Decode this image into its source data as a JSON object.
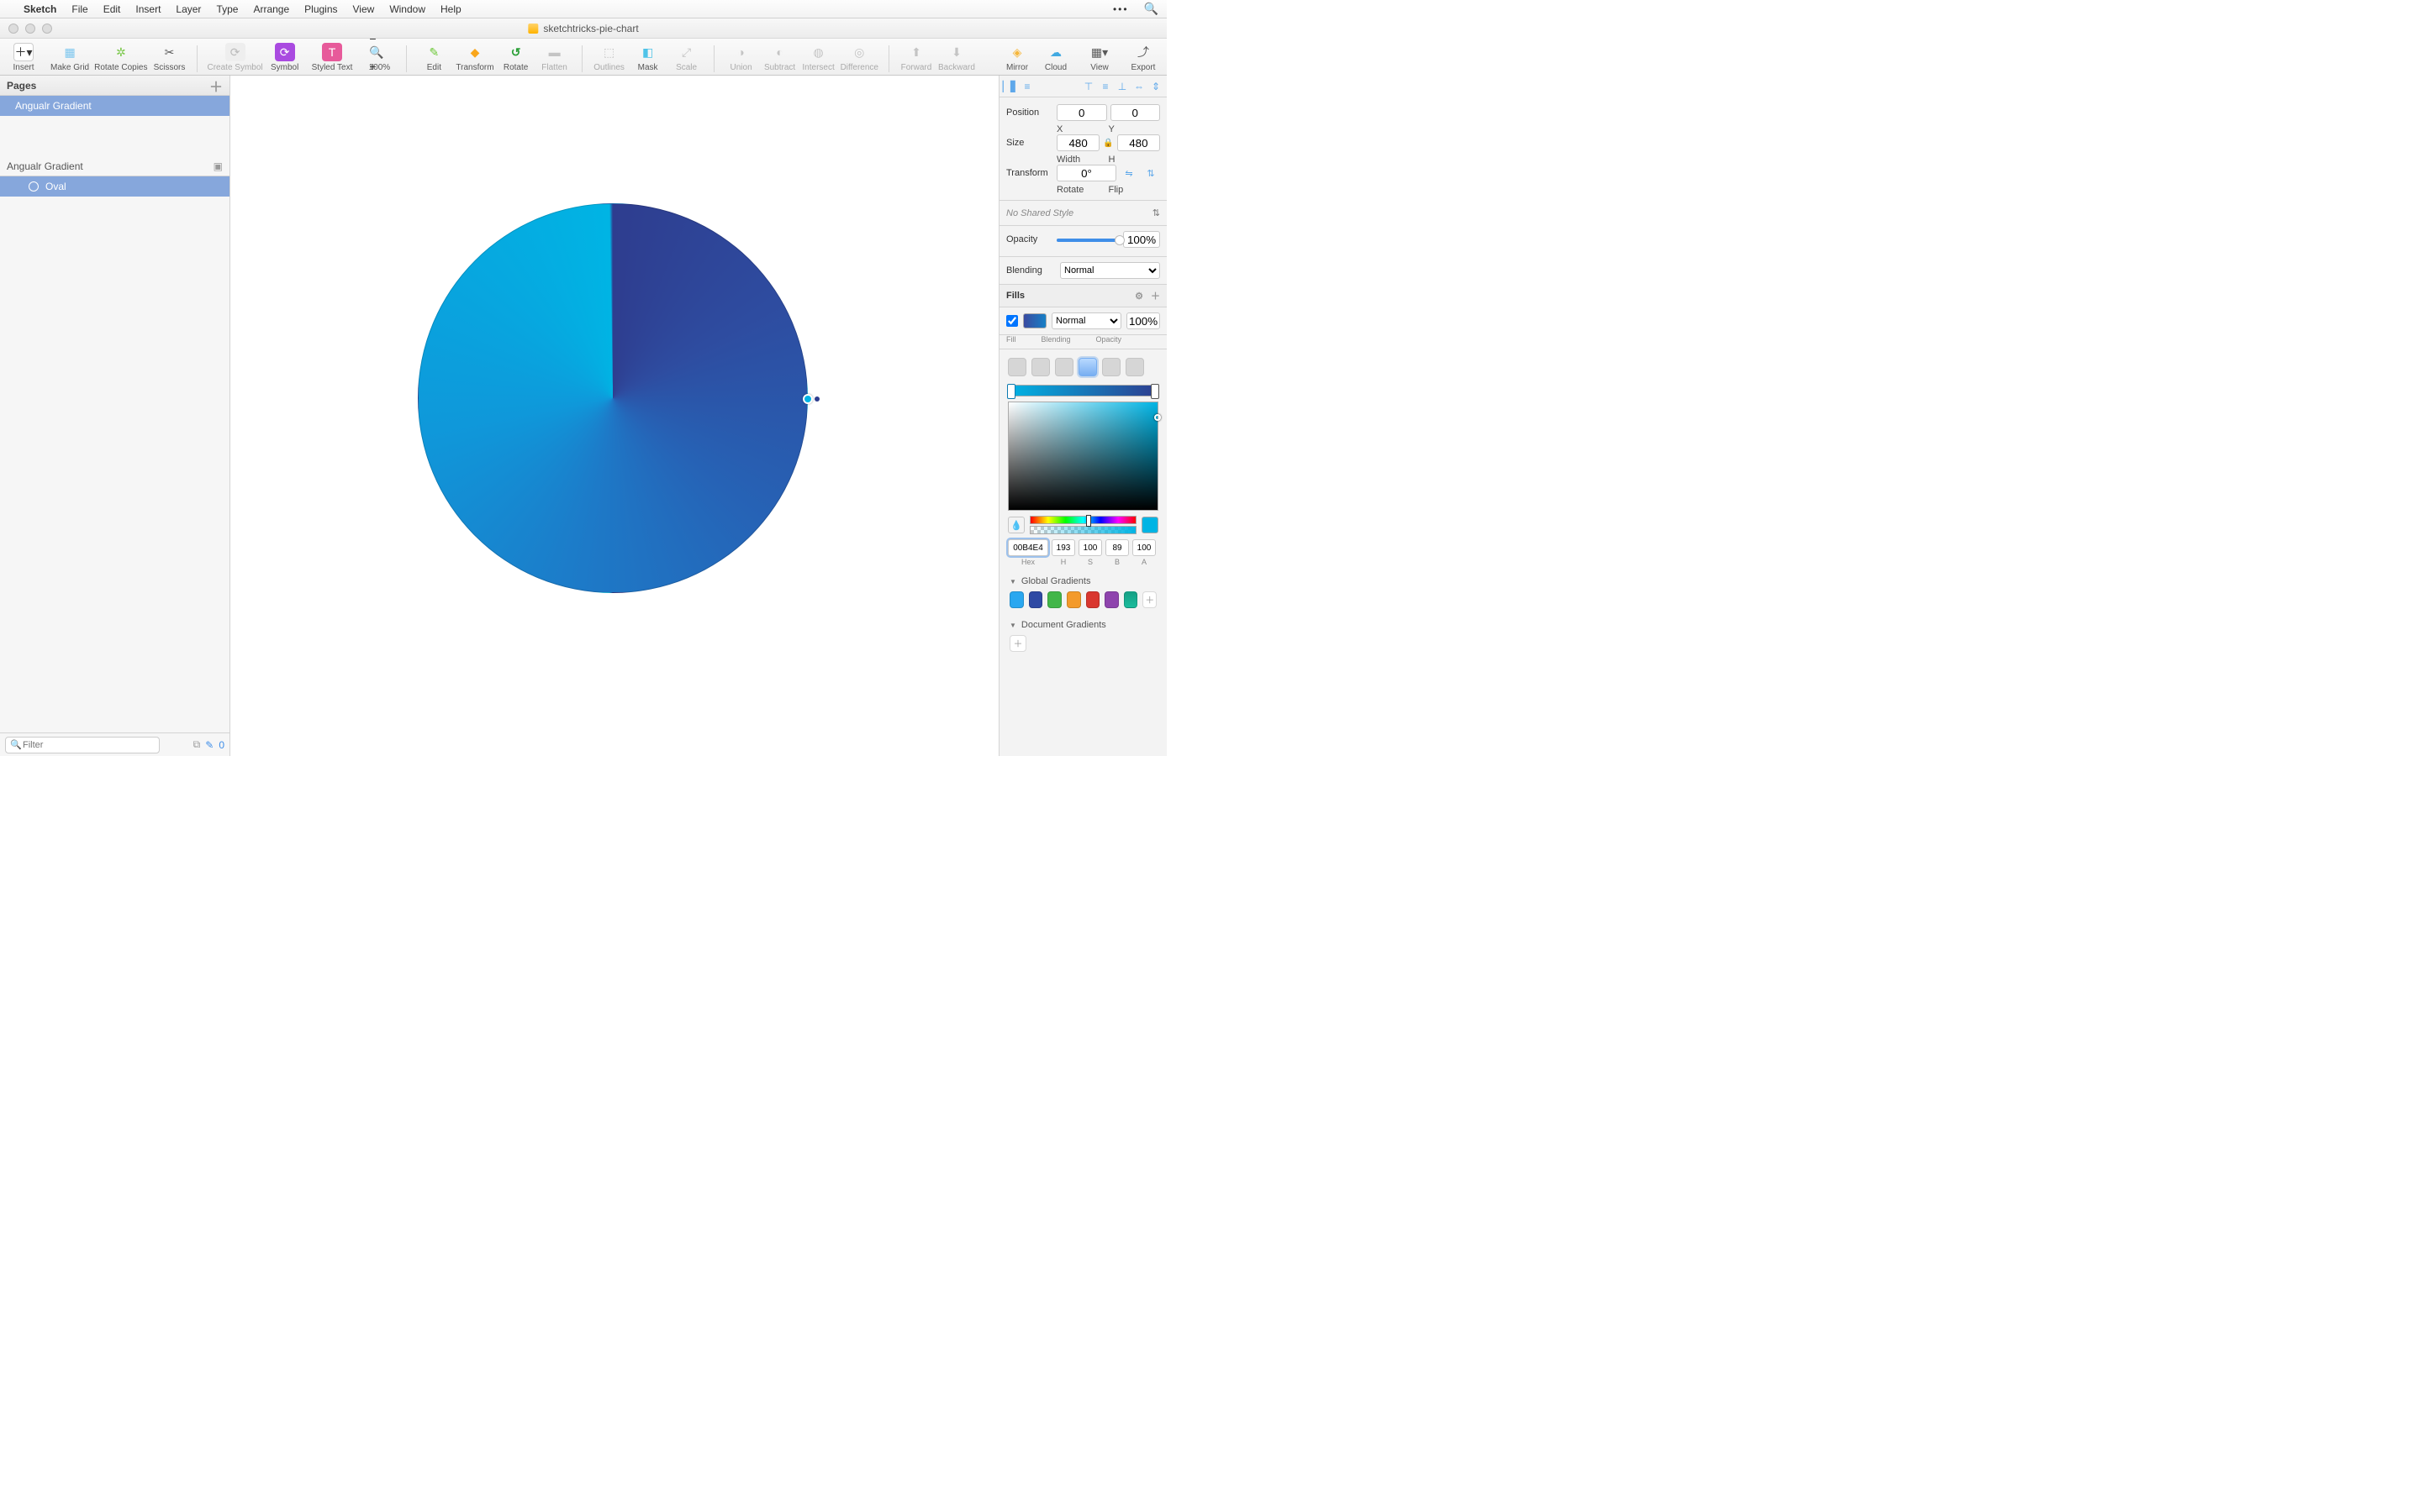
{
  "menubar": {
    "app": "Sketch",
    "items": [
      "File",
      "Edit",
      "Insert",
      "Layer",
      "Type",
      "Arrange",
      "Plugins",
      "View",
      "Window",
      "Help"
    ]
  },
  "window": {
    "title": "sketchtricks-pie-chart"
  },
  "toolbar": {
    "insert": "Insert",
    "makeGrid": "Make Grid",
    "rotateCopies": "Rotate Copies",
    "scissors": "Scissors",
    "createSymbol": "Create Symbol",
    "symbol": "Symbol",
    "styledText": "Styled Text",
    "zoom": "100%",
    "edit": "Edit",
    "transform": "Transform",
    "rotate": "Rotate",
    "flatten": "Flatten",
    "outlines": "Outlines",
    "mask": "Mask",
    "scale": "Scale",
    "union": "Union",
    "subtract": "Subtract",
    "intersect": "Intersect",
    "difference": "Difference",
    "forward": "Forward",
    "backward": "Backward",
    "mirror": "Mirror",
    "cloud": "Cloud",
    "view": "View",
    "export": "Export"
  },
  "sidebar": {
    "pagesHeader": "Pages",
    "page": "Angualr Gradient",
    "artboard": "Angualr Gradient",
    "layer": "Oval",
    "filterPlaceholder": "Filter",
    "badge": "0"
  },
  "inspector": {
    "positionLabel": "Position",
    "posX": "0",
    "posY": "0",
    "xLabel": "X",
    "yLabel": "Y",
    "sizeLabel": "Size",
    "width": "480",
    "height": "480",
    "wLabel": "Width",
    "hLabel": "H",
    "lock": "🔒",
    "transformLabel": "Transform",
    "rotate": "0°",
    "rotateLabel": "Rotate",
    "flipLabel": "Flip",
    "sharedStyle": "No Shared Style",
    "opacityLabel": "Opacity",
    "opacityValue": "100%",
    "blendingLabel": "Blending",
    "blendingValue": "Normal",
    "fillsHeader": "Fills",
    "fillBlending": "Normal",
    "fillOpacity": "100%",
    "fillSubFill": "Fill",
    "fillSubBlend": "Blending",
    "fillSubOpacity": "Opacity",
    "hex": "00B4E4",
    "H": "193",
    "S": "100",
    "B": "89",
    "A": "100",
    "hexLabel": "Hex",
    "sLabel": "S",
    "bLabel": "B",
    "aLabel": "A",
    "globalGradients": "Global Gradients",
    "documentGradients": "Document Gradients"
  },
  "gradientSwatches": [
    "#2aa7f0",
    "#2f4aa4",
    "#42b649",
    "#f39a2b",
    "#d9372f",
    "#8e44ad",
    "#16a085"
  ]
}
